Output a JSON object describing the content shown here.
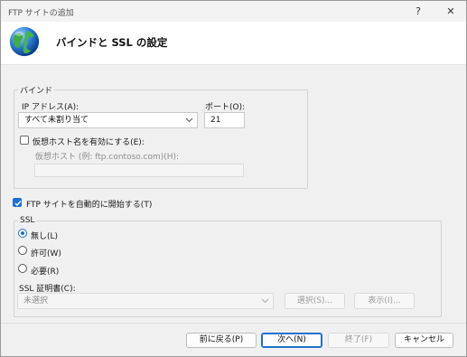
{
  "window": {
    "title": "FTP サイトの追加"
  },
  "titlebar_buttons": {
    "help": "?",
    "close": "✕"
  },
  "header": {
    "title": "バインドと SSL の設定"
  },
  "binding": {
    "group_label": "バインド",
    "ip_label": "IP アドレス(A):",
    "ip_value": "すべて未割り当て",
    "port_label": "ポート(O):",
    "port_value": "21",
    "virtual_host_checkbox": "仮想ホスト名を有効にする(E):",
    "virtual_host_checked": false,
    "virtual_host_label": "仮想ホスト (例: ftp.contoso.com)(H):",
    "virtual_host_value": ""
  },
  "auto_start": {
    "label": "FTP サイトを自動的に開始する(T)",
    "checked": true
  },
  "ssl": {
    "group_label": "SSL",
    "options": [
      "無し(L)",
      "許可(W)",
      "必要(R)"
    ],
    "selected": "無し(L)",
    "cert_label": "SSL 証明書(C):",
    "cert_value": "未選択",
    "select_button": "選択(S)...",
    "view_button": "表示(I)..."
  },
  "footer": {
    "back": "前に戻る(P)",
    "next": "次へ(N)",
    "finish": "終了(F)",
    "cancel": "キャンセル"
  },
  "colors": {
    "accent": "#1f6fd1",
    "dialog_bg": "#f0f0f0"
  },
  "icons": {
    "header": "globe-icon",
    "dropdown": "chevron-down-icon"
  }
}
